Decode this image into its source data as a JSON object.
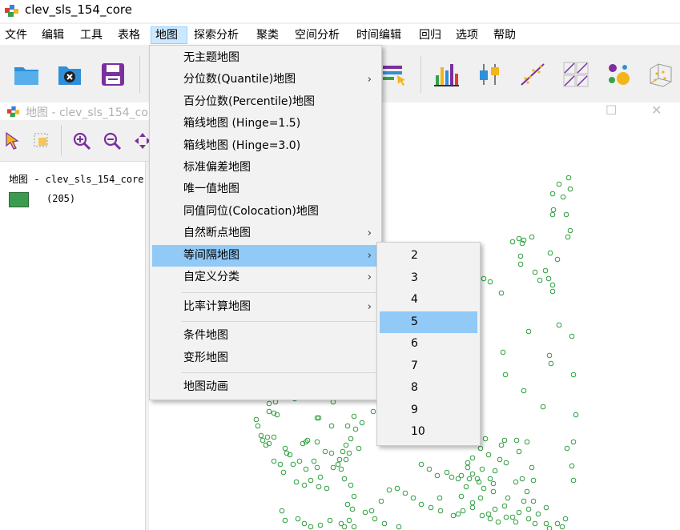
{
  "window": {
    "title": "clev_sls_154_core"
  },
  "menubar": {
    "items": [
      {
        "label": "文件"
      },
      {
        "label": "编辑"
      },
      {
        "label": "工具"
      },
      {
        "label": "表格"
      },
      {
        "label": "地图"
      },
      {
        "label": "探索分析"
      },
      {
        "label": "聚类"
      },
      {
        "label": "空间分析"
      },
      {
        "label": "时间编辑"
      },
      {
        "label": "回归"
      },
      {
        "label": "选项"
      },
      {
        "label": "帮助"
      }
    ]
  },
  "map_window": {
    "title": "地图 - clev_sls_154_core"
  },
  "legend": {
    "title": "地图 - clev_sls_154_core",
    "category_count": "(205)",
    "swatch_color": "#3c9b4f"
  },
  "map_menu": {
    "items": [
      {
        "label": "无主题地图"
      },
      {
        "label": "分位数(Quantile)地图",
        "arrow": "›"
      },
      {
        "label": "百分位数(Percentile)地图"
      },
      {
        "label": "箱线地图 (Hinge=1.5)"
      },
      {
        "label": "箱线地图 (Hinge=3.0)"
      },
      {
        "label": "标准偏差地图"
      },
      {
        "label": "唯一值地图"
      },
      {
        "label": "同值同位(Colocation)地图"
      },
      {
        "label": "自然断点地图",
        "arrow": "›"
      },
      {
        "label": "等间隔地图",
        "arrow": "›"
      },
      {
        "label": "自定义分类",
        "arrow": "›"
      },
      {
        "label": "比率计算地图",
        "arrow": "›"
      },
      {
        "label": "条件地图"
      },
      {
        "label": "变形地图"
      },
      {
        "label": "地图动画"
      }
    ]
  },
  "submenu": {
    "items": [
      "2",
      "3",
      "4",
      "5",
      "6",
      "7",
      "8",
      "9",
      "10"
    ]
  },
  "colors": {
    "accent_highlight": "#91c9f7",
    "menu_active": "#cce8ff",
    "point_color": "#2e9e3e"
  }
}
